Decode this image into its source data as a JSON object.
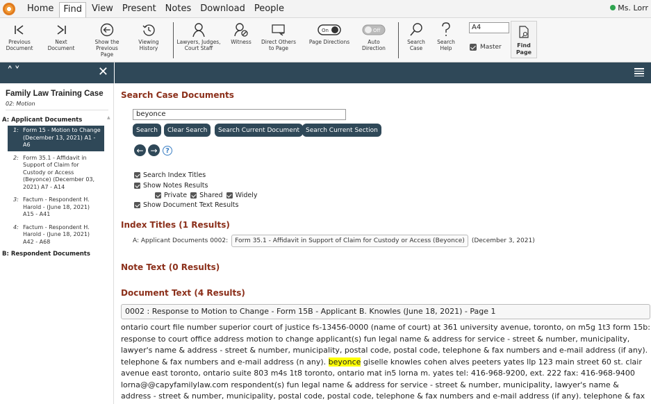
{
  "menu": {
    "items": [
      "Home",
      "Find",
      "View",
      "Present",
      "Notes",
      "Download",
      "People"
    ],
    "active": "Find",
    "user": "Ms. Lorr"
  },
  "toolbar": {
    "prev_doc": "Previous Document",
    "next_doc": "Next Document",
    "show_prev": "Show the Previous Page",
    "viewing_history": "Viewing History",
    "lawyers": "Lawyers, Judges, Court Staff",
    "witness": "Witness",
    "direct_others": "Direct Others to Page",
    "page_directions": "Page Directions",
    "page_directions_toggle": "On",
    "auto_direction": "Auto Direction",
    "auto_direction_toggle": "Off",
    "search_case": "Search Case",
    "search_help": "Search Help",
    "page_input": "A4",
    "master": "Master",
    "find_page": "Find Page"
  },
  "sidebar": {
    "case_title": "Family Law Training Case",
    "case_sub": "02: Motion",
    "section_a": "A:  Applicant Documents",
    "docs": [
      {
        "num": "1:",
        "label": "Form 15 - Motion to Change (December 13, 2021) A1 - A6"
      },
      {
        "num": "2:",
        "label": "Form 35.1 - Affidavit in Support of Claim for Custody or Access (Beyonce) (December 03, 2021) A7 - A14"
      },
      {
        "num": "3:",
        "label": "Factum - Respondent H. Harold - (June 18, 2021) A15 - A41"
      },
      {
        "num": "4:",
        "label": "Factum - Respondent H. Harold - (June 18, 2021) A42 - A68"
      }
    ],
    "section_b": "B:  Respondent Documents"
  },
  "main": {
    "search_heading": "Search Case Documents",
    "search_value": "beyonce",
    "buttons": {
      "search": "Search",
      "clear": "Clear Search",
      "current_doc": "Search Current Document",
      "current_sec": "Search Current Section"
    },
    "options": {
      "index_titles": "Search Index Titles",
      "notes_results": "Show Notes Results",
      "private": "Private",
      "shared": "Shared",
      "widely": "Widely",
      "doc_text": "Show Document Text Results"
    },
    "index_heading": "Index Titles (1 Results)",
    "index_prefix": "A: Applicant Documents   0002:",
    "index_link": "Form 35.1 - Affidavit in Support of Claim for Custody or Access (Beyonce)",
    "index_date": "(December 3, 2021)",
    "notes_heading": "Note Text (0 Results)",
    "doctext_heading": "Document Text (4 Results)",
    "doc_bar": "0002 : Response to Motion to Change - Form 15B - Applicant B. Knowles (June 18, 2021) - Page 1",
    "text_before": "ontario court file number superior court of justice fs-13456-0000 (name of court) at 361 university avenue, toronto, on m5g 1t3 form 15b: response to court office address motion to change applicant(s) fun legal name & address for service - street & number, municipality, lawyer's name & address - street & number, municipality, postal code, postal code, telephone & fax numbers and e-mail address (if any). telephone & fax numbers and e-mail address (n any). ",
    "text_highlight": "beyonce",
    "text_after": " giselle knowles cohen alves peeters yates llp 123 main street 60 st. clair avenue east toronto, ontario suite 803 m4s 1t8 toronto, ontario mat in5 lorna m. yates tel: 416-968-9200, ext. 222 fax: 416-968-9400 lorna@@capyfamilylaw.com respondent(s) fun legal name & address for service - street & number, municipality, lawyer's name & address - street & number, municipality, postal code, postal code, telephone & fax numbers and e-mail address (if any). telephone & fax numbers and e-mail ad"
  },
  "colors": {
    "accent_dark": "#2f4858",
    "heading_red": "#8b2f1a",
    "highlight": "#ffff00",
    "status_green": "#2ea44f"
  }
}
